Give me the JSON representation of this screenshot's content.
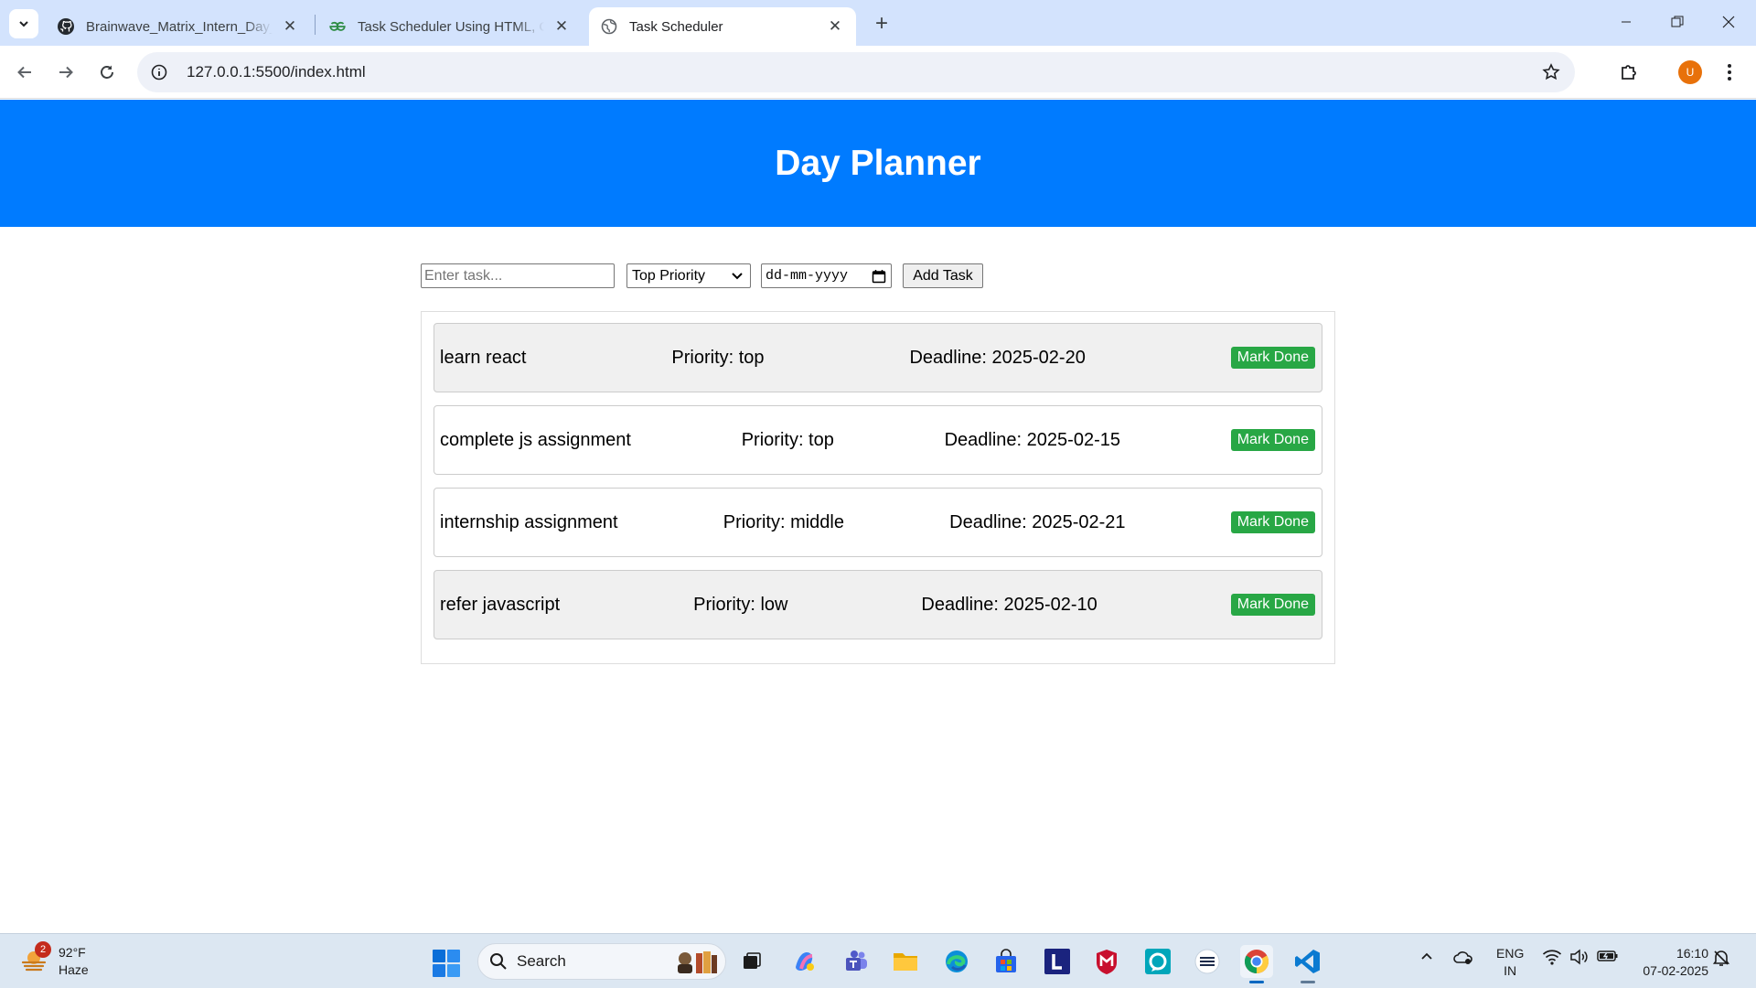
{
  "browser": {
    "tabs": [
      {
        "title": "Brainwave_Matrix_Intern_Day_P",
        "icon": "github-icon",
        "active": false
      },
      {
        "title": "Task Scheduler Using HTML, CS",
        "icon": "geeksforgeeks-icon",
        "active": false
      },
      {
        "title": "Task Scheduler",
        "icon": "globe-icon",
        "active": true
      }
    ],
    "url": "127.0.0.1:5500/index.html",
    "profile_initial": "U"
  },
  "page": {
    "title": "Day Planner",
    "form": {
      "task_placeholder": "Enter task...",
      "priority_selected": "Top Priority",
      "date_placeholder": "dd-mm-yyyy",
      "add_label": "Add Task"
    },
    "tasks": [
      {
        "name": "learn react",
        "priority": "Priority: top",
        "deadline": "Deadline: 2025-02-20",
        "action": "Mark Done"
      },
      {
        "name": "complete js assignment",
        "priority": "Priority: top",
        "deadline": "Deadline: 2025-02-15",
        "action": "Mark Done"
      },
      {
        "name": "internship assignment",
        "priority": "Priority: middle",
        "deadline": "Deadline: 2025-02-21",
        "action": "Mark Done"
      },
      {
        "name": "refer javascript",
        "priority": "Priority: low",
        "deadline": "Deadline: 2025-02-10",
        "action": "Mark Done"
      }
    ],
    "colors": {
      "header": "#007bff",
      "done_button": "#28a745",
      "task_shaded": "#f0f0f0"
    }
  },
  "taskbar": {
    "weather": {
      "temp": "92°F",
      "condition": "Haze",
      "badge": "2"
    },
    "search_label": "Search",
    "language": {
      "line1": "ENG",
      "line2": "IN"
    },
    "clock": {
      "time": "16:10",
      "date": "07-02-2025"
    }
  }
}
